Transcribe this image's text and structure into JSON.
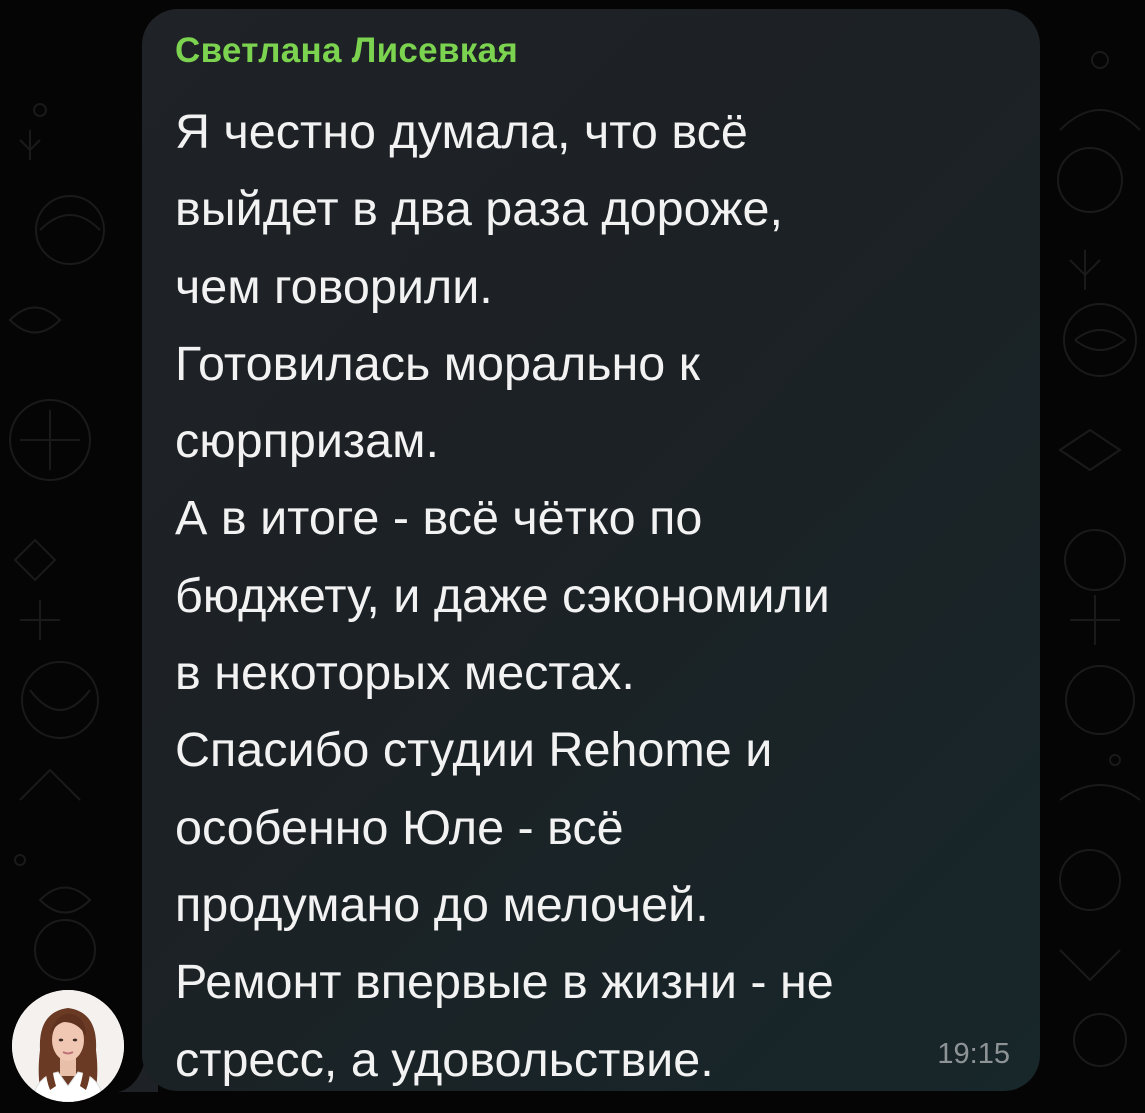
{
  "message": {
    "sender_name": "Светлана Лисевкая",
    "lines": [
      "Я честно думала, что всё",
      "выйдет в два раза дороже,",
      "чем говорили.",
      "Готовилась морально к",
      "сюрпризам.",
      "А в итоге - всё чётко по",
      "бюджету, и даже сэкономили",
      "в некоторых местах.",
      "Спасибо студии Rehome и",
      "особенно Юле - всё",
      "продумано до мелочей.",
      "Ремонт впервые в жизни - не",
      "стресс, а удовольствие."
    ],
    "time": "19:15"
  },
  "colors": {
    "sender_name": "#7bd34f",
    "bubble": "#1e2226",
    "text": "#f2f2f2",
    "time": "#8e9396",
    "background": "#050505"
  },
  "icons": {
    "avatar": "user-avatar-photo",
    "background": "doodle-pattern"
  }
}
